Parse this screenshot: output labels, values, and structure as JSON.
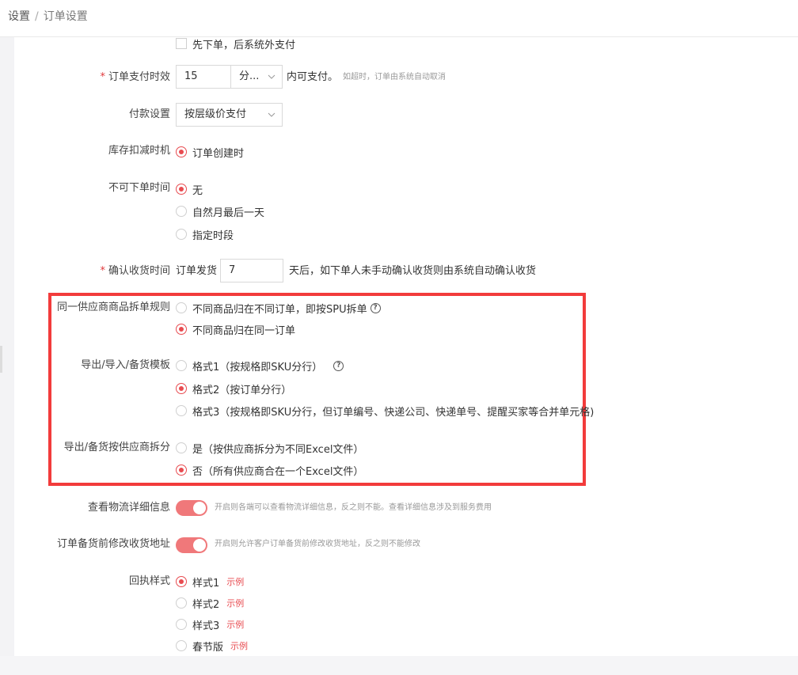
{
  "breadcrumb": {
    "root": "设置",
    "separator": "/",
    "current": "订单设置"
  },
  "top_option": {
    "label": "先下单，后系统外支付",
    "checked": false
  },
  "payment_timeout": {
    "label": "订单支付时效",
    "required": true,
    "value": "15",
    "unit": "分...",
    "suffix": "内可支付。",
    "hint": "如超时，订单由系统自动取消"
  },
  "payment_setting": {
    "label": "付款设置",
    "value": "按层级价支付"
  },
  "stock_deduct": {
    "label": "库存扣减时机",
    "options": [
      {
        "text": "订单创建时",
        "checked": true
      }
    ]
  },
  "no_order_time": {
    "label": "不可下单时间",
    "options": [
      {
        "text": "无",
        "checked": true
      },
      {
        "text": "自然月最后一天",
        "checked": false
      },
      {
        "text": "指定时段",
        "checked": false
      }
    ]
  },
  "confirm_receipt": {
    "label": "确认收货时间",
    "required": true,
    "prefix": "订单发货",
    "value": "7",
    "suffix": "天后，如下单人未手动确认收货则由系统自动确认收货"
  },
  "split_rule": {
    "label": "同一供应商商品拆单规则",
    "options": [
      {
        "text": "不同商品归在不同订单，即按SPU拆单",
        "checked": false,
        "help": "?"
      },
      {
        "text": "不同商品归在同一订单",
        "checked": true
      }
    ]
  },
  "export_template": {
    "label": "导出/导入/备货模板",
    "options": [
      {
        "text": "格式1（按规格即SKU分行）",
        "checked": false,
        "help": "?"
      },
      {
        "text": "格式2（按订单分行）",
        "checked": true
      },
      {
        "text": "格式3（按规格即SKU分行，但订单编号、快递公司、快递单号、提醒买家等合并单元格)",
        "checked": false
      }
    ]
  },
  "export_split": {
    "label": "导出/备货按供应商拆分",
    "options": [
      {
        "text": "是（按供应商拆分为不同Excel文件）",
        "checked": false
      },
      {
        "text": "否（所有供应商合在一个Excel文件）",
        "checked": true
      }
    ]
  },
  "logistics_detail": {
    "label": "查看物流详细信息",
    "on": true,
    "hint": "开启则各端可以查看物流详细信息，反之则不能。查看详细信息涉及到服务费用"
  },
  "modify_address": {
    "label": "订单备货前修改收货地址",
    "on": true,
    "hint": "开启则允许客户订单备货前修改收货地址，反之则不能修改"
  },
  "receipt_style": {
    "label": "回执样式",
    "example_label": "示例",
    "options": [
      {
        "text": "样式1",
        "checked": true
      },
      {
        "text": "样式2",
        "checked": false
      },
      {
        "text": "样式3",
        "checked": false
      },
      {
        "text": "春节版",
        "checked": false
      }
    ]
  },
  "colors": {
    "accent": "#e84b50",
    "highlight_border": "#f23b3b",
    "switch_on": "#f0787a"
  }
}
